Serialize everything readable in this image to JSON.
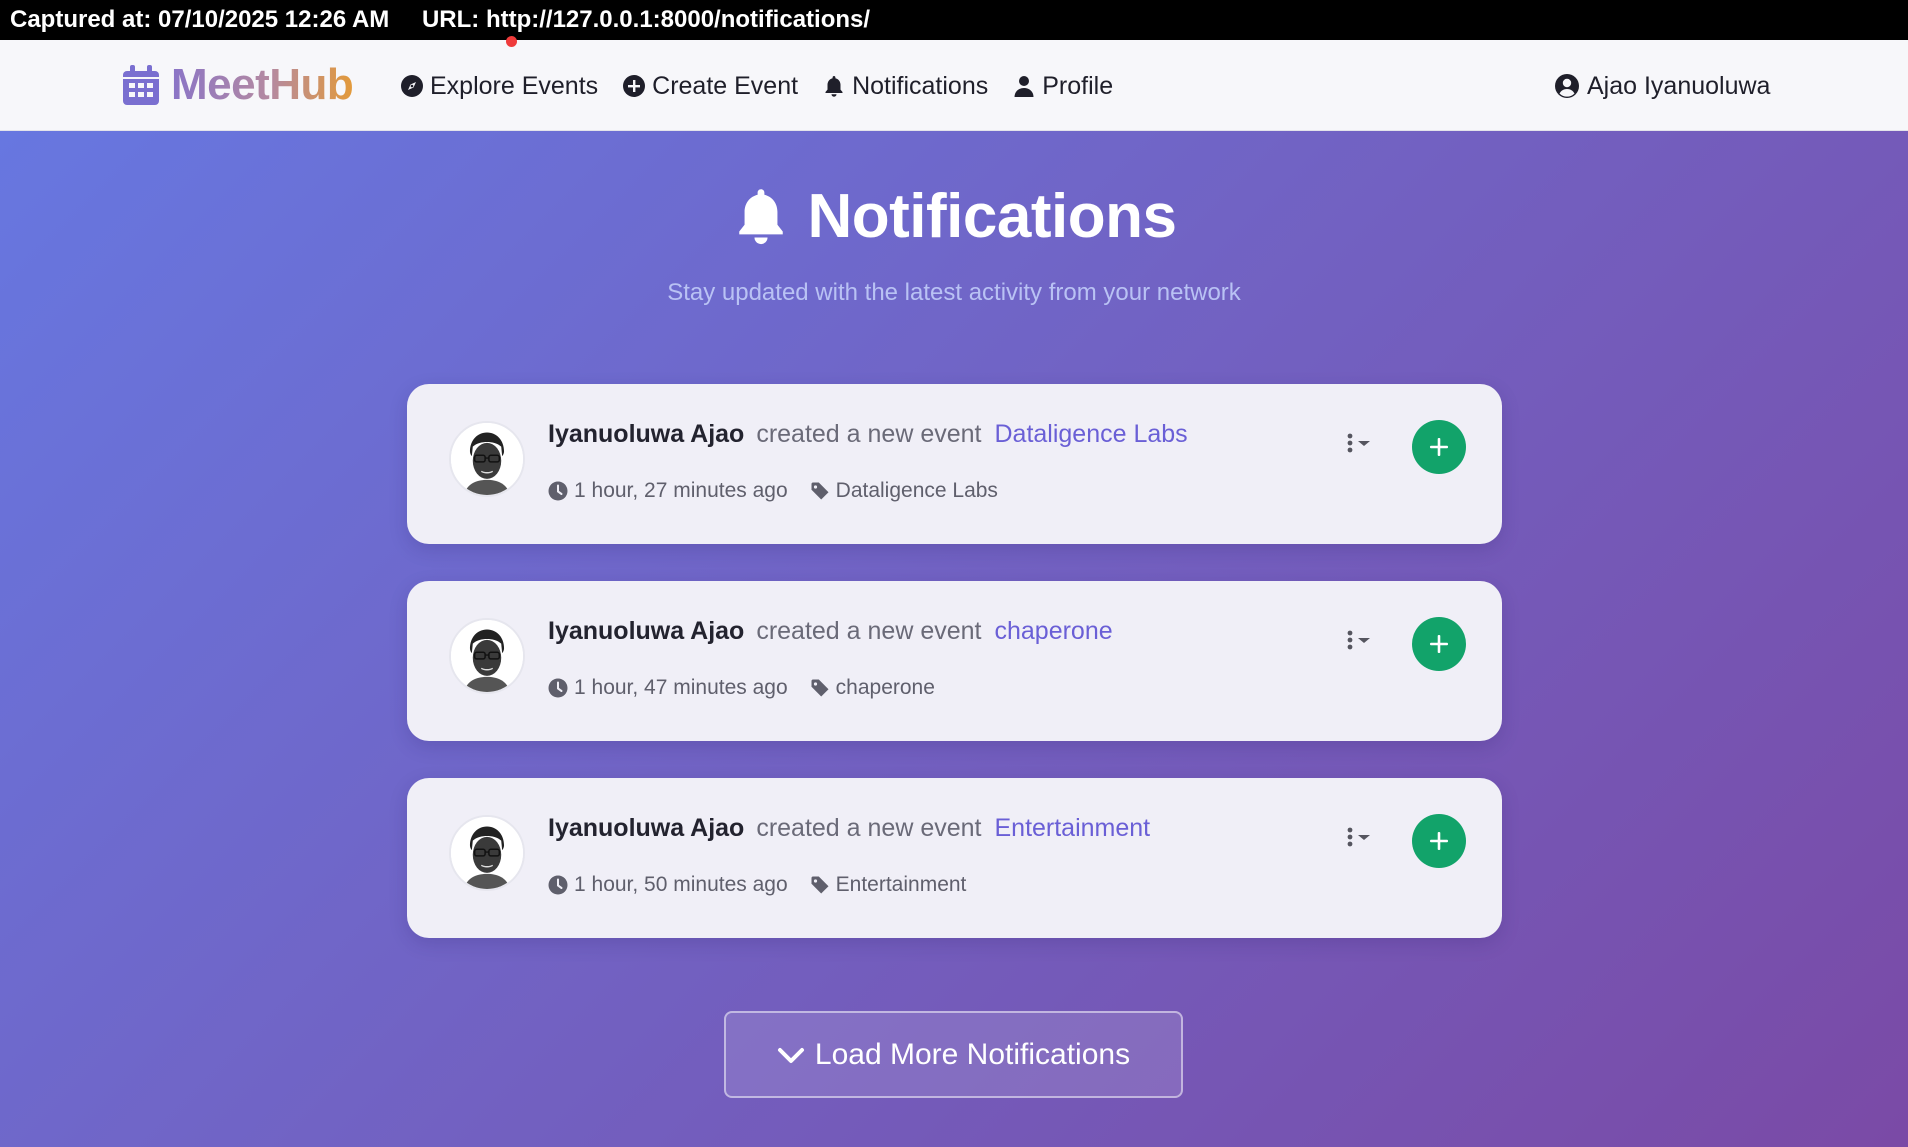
{
  "capture": {
    "captured_at": "Captured at: 07/10/2025 12:26 AM",
    "url": "URL: http://127.0.0.1:8000/notifications/"
  },
  "navbar": {
    "brand": "MeetHub",
    "links": [
      {
        "label": "Explore Events",
        "icon": "compass-icon"
      },
      {
        "label": "Create Event",
        "icon": "plus-circle-icon"
      },
      {
        "label": "Notifications",
        "icon": "bell-icon"
      },
      {
        "label": "Profile",
        "icon": "user-icon"
      }
    ],
    "user": "Ajao Iyanuoluwa",
    "notification_indicator_color": "#ef3b3b"
  },
  "page": {
    "title": "Notifications",
    "subtitle": "Stay updated with the latest activity from your network"
  },
  "notifications": [
    {
      "actor": "Iyanuoluwa Ajao",
      "verb": "created a new event",
      "event": "Dataligence Labs",
      "time": "1 hour, 27 minutes ago",
      "tag": "Dataligence Labs"
    },
    {
      "actor": "Iyanuoluwa Ajao",
      "verb": "created a new event",
      "event": "chaperone",
      "time": "1 hour, 47 minutes ago",
      "tag": "chaperone"
    },
    {
      "actor": "Iyanuoluwa Ajao",
      "verb": "created a new event",
      "event": "Entertainment",
      "time": "1 hour, 50 minutes ago",
      "tag": "Entertainment"
    }
  ],
  "load_more": "Load More Notifications",
  "colors": {
    "accent": "#6a5fd6",
    "add_button": "#12a36a",
    "gradient_start": "#6777e0",
    "gradient_end": "#7a4aa6"
  }
}
